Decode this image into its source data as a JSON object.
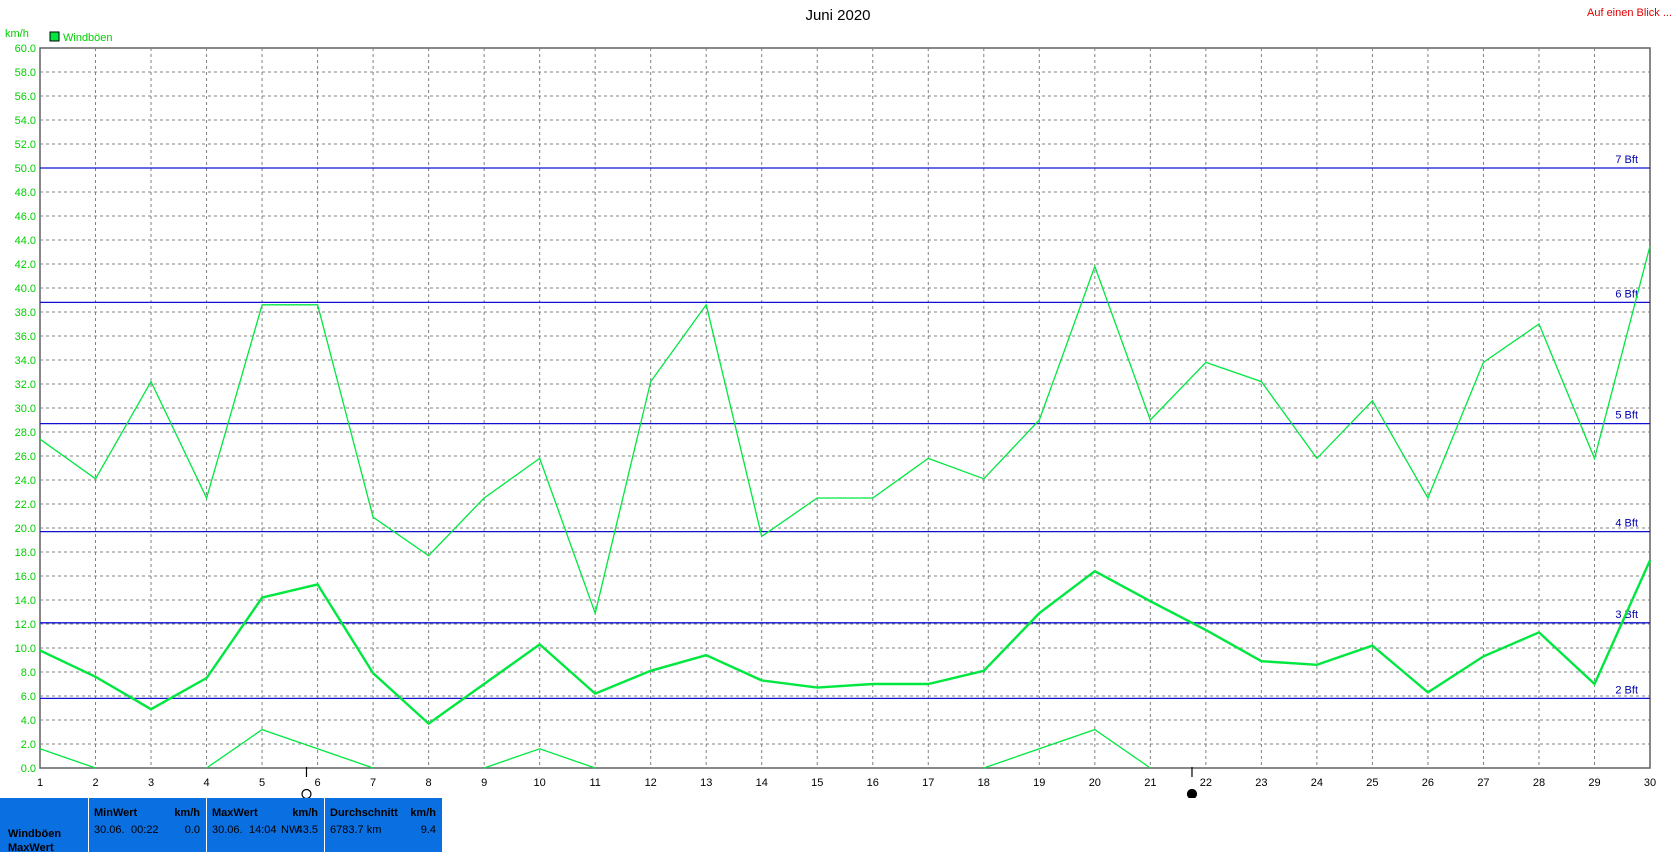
{
  "header": {
    "link_label": "Auf einen Blick ..."
  },
  "colors": {
    "series": "#00e840",
    "bft_lines": "#1010d0",
    "grid": "#808080",
    "panel_bg": "#0a6fe0",
    "link": "#e00000"
  },
  "chart_data": {
    "type": "line",
    "title": "Juni 2020",
    "ylabel": "km/h",
    "ylim": [
      0,
      60
    ],
    "ytick_step": 2,
    "x": [
      1,
      2,
      3,
      4,
      5,
      6,
      7,
      8,
      9,
      10,
      11,
      12,
      13,
      14,
      15,
      16,
      17,
      18,
      19,
      20,
      21,
      22,
      23,
      24,
      25,
      26,
      27,
      28,
      29,
      30
    ],
    "xlim": [
      1,
      30
    ],
    "legend": [
      {
        "label": "Windböen",
        "color": "#00e840"
      }
    ],
    "series": [
      {
        "name": "Windböen",
        "role": "max",
        "values": [
          27.4,
          24.1,
          32.2,
          22.5,
          38.6,
          38.6,
          20.9,
          17.7,
          22.5,
          25.8,
          12.9,
          32.2,
          38.6,
          19.3,
          22.5,
          22.5,
          25.8,
          24.1,
          29.0,
          41.8,
          29.0,
          33.8,
          32.2,
          25.8,
          30.6,
          22.5,
          33.8,
          37.0,
          25.8,
          43.5
        ]
      },
      {
        "name": "Windböen",
        "role": "avg",
        "values": [
          9.8,
          7.6,
          4.9,
          7.5,
          14.2,
          15.3,
          7.9,
          3.7,
          7.0,
          10.3,
          6.2,
          8.1,
          9.4,
          7.3,
          6.7,
          7.0,
          7.0,
          8.1,
          12.9,
          16.4,
          13.9,
          11.5,
          8.9,
          8.6,
          10.2,
          6.3,
          9.3,
          11.3,
          7.0,
          17.3
        ]
      },
      {
        "name": "Windböen",
        "role": "min",
        "values": [
          1.6,
          0.0,
          null,
          0.0,
          3.2,
          1.6,
          0.0,
          null,
          0.0,
          1.6,
          0.0,
          null,
          null,
          null,
          null,
          null,
          null,
          0.0,
          1.6,
          3.2,
          0.0,
          null,
          null,
          null,
          null,
          null,
          null,
          null,
          null,
          null
        ]
      }
    ],
    "reference_lines": [
      {
        "label": "7 Bft",
        "value": 50.0
      },
      {
        "label": "6 Bft",
        "value": 38.8
      },
      {
        "label": "5 Bft",
        "value": 28.7
      },
      {
        "label": "4 Bft",
        "value": 19.7
      },
      {
        "label": "3 Bft",
        "value": 12.1
      },
      {
        "label": "2 Bft",
        "value": 5.8
      }
    ],
    "moon_markers": [
      {
        "day": 5.8,
        "phase": "full"
      },
      {
        "day": 21.75,
        "phase": "new"
      }
    ],
    "grid": true
  },
  "stats": {
    "row_labels": [
      "Windböen",
      "MaxWert"
    ],
    "min": {
      "header": "MinWert",
      "unit": "km/h",
      "date": "30.06.",
      "time": "00:22",
      "value": "0.0"
    },
    "max": {
      "header": "MaxWert",
      "unit": "km/h",
      "date": "30.06.",
      "time": "14:04",
      "dir": "NW",
      "value": "43.5"
    },
    "avg": {
      "header": "Durchschnitt",
      "unit": "km/h",
      "distance": "6783.7 km",
      "value": "9.4"
    }
  }
}
